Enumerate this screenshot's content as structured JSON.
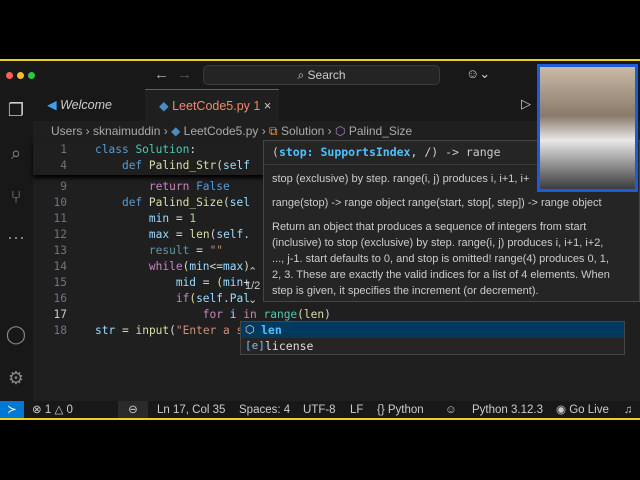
{
  "titlebar": {
    "search_label": "Search",
    "back_icon": "←",
    "forward_icon": "→"
  },
  "tabs": [
    {
      "label": "Welcome"
    },
    {
      "label": "LeetCode5.py",
      "badge": "1",
      "close": "×"
    }
  ],
  "breadcrumb": [
    "Users",
    "sknaimuddin",
    "LeetCode5.py",
    "Solution",
    "Palind_Size"
  ],
  "code": {
    "l1": {
      "n": "1"
    },
    "l4": {
      "n": "4"
    },
    "l9": {
      "n": "9"
    },
    "l10": {
      "n": "10"
    },
    "l11": {
      "n": "11"
    },
    "l12": {
      "n": "12"
    },
    "l13": {
      "n": "13"
    },
    "l14": {
      "n": "14"
    },
    "l15": {
      "n": "15"
    },
    "l16": {
      "n": "16"
    },
    "l17": {
      "n": "17"
    },
    "l18": {
      "n": "18"
    }
  },
  "param_hint": {
    "counter": "1/2"
  },
  "hover": {
    "signature_open": "(",
    "param": "stop: SupportsIndex",
    "signature_rest": ", /) -> range",
    "line1": "stop (exclusive) by step. range(i, j) produces i, i+1, i+",
    "line2": "range(stop) -> range object range(start, stop[, step]) -> range object",
    "para": [
      "Return an object that produces a sequence of integers from start",
      "(inclusive) to stop (exclusive) by step. range(i, j) produces i, i+1, i+2,",
      "..., j-1. start defaults to 0, and stop is omitted! range(4) produces 0, 1,",
      "2, 3. These are exactly the valid indices for a list of 4 elements. When",
      "step is given, it specifies the increment (or decrement)."
    ]
  },
  "suggestions": [
    {
      "label": "len"
    },
    {
      "label": "license"
    }
  ],
  "status": {
    "errors": "1",
    "warnings": "0",
    "position": "Ln 17, Col 35",
    "spaces": "Spaces: 4",
    "encoding": "UTF-8",
    "eol": "LF",
    "language": "Python",
    "interpreter": "Python 3.12.3",
    "golive": "Go Live"
  },
  "colors": {
    "accent": "#0078d4",
    "frame": "#e8d41c",
    "tab_error": "#f48771"
  }
}
